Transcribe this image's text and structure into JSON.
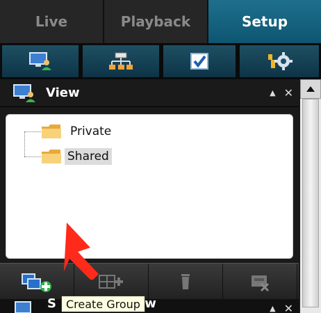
{
  "tabs": [
    {
      "label": "Live",
      "active": false
    },
    {
      "label": "Playback",
      "active": false
    },
    {
      "label": "Setup",
      "active": true
    }
  ],
  "toolbar": {
    "icons": [
      "monitor-user-icon",
      "network-icon",
      "checklist-icon",
      "tools-gear-icon"
    ]
  },
  "view_panel": {
    "title": "View",
    "collapse_symbol": "▲",
    "close_symbol": "✕",
    "tree": [
      {
        "label": "Private",
        "selected": false
      },
      {
        "label": "Shared",
        "selected": true
      }
    ],
    "buttons": [
      "create-group",
      "layout-add",
      "delete-item",
      "delete-group"
    ]
  },
  "panel2": {
    "title_start": "S",
    "title_end": "ew",
    "collapse_symbol": "▲",
    "close_symbol": "✕"
  },
  "tooltip": {
    "text": "Create Group"
  },
  "colors": {
    "active_tab": "#0d5672",
    "toolbar_bg": "#1e4f63",
    "folder": "#f2c35c",
    "red_arrow": "#ff2a1a"
  }
}
